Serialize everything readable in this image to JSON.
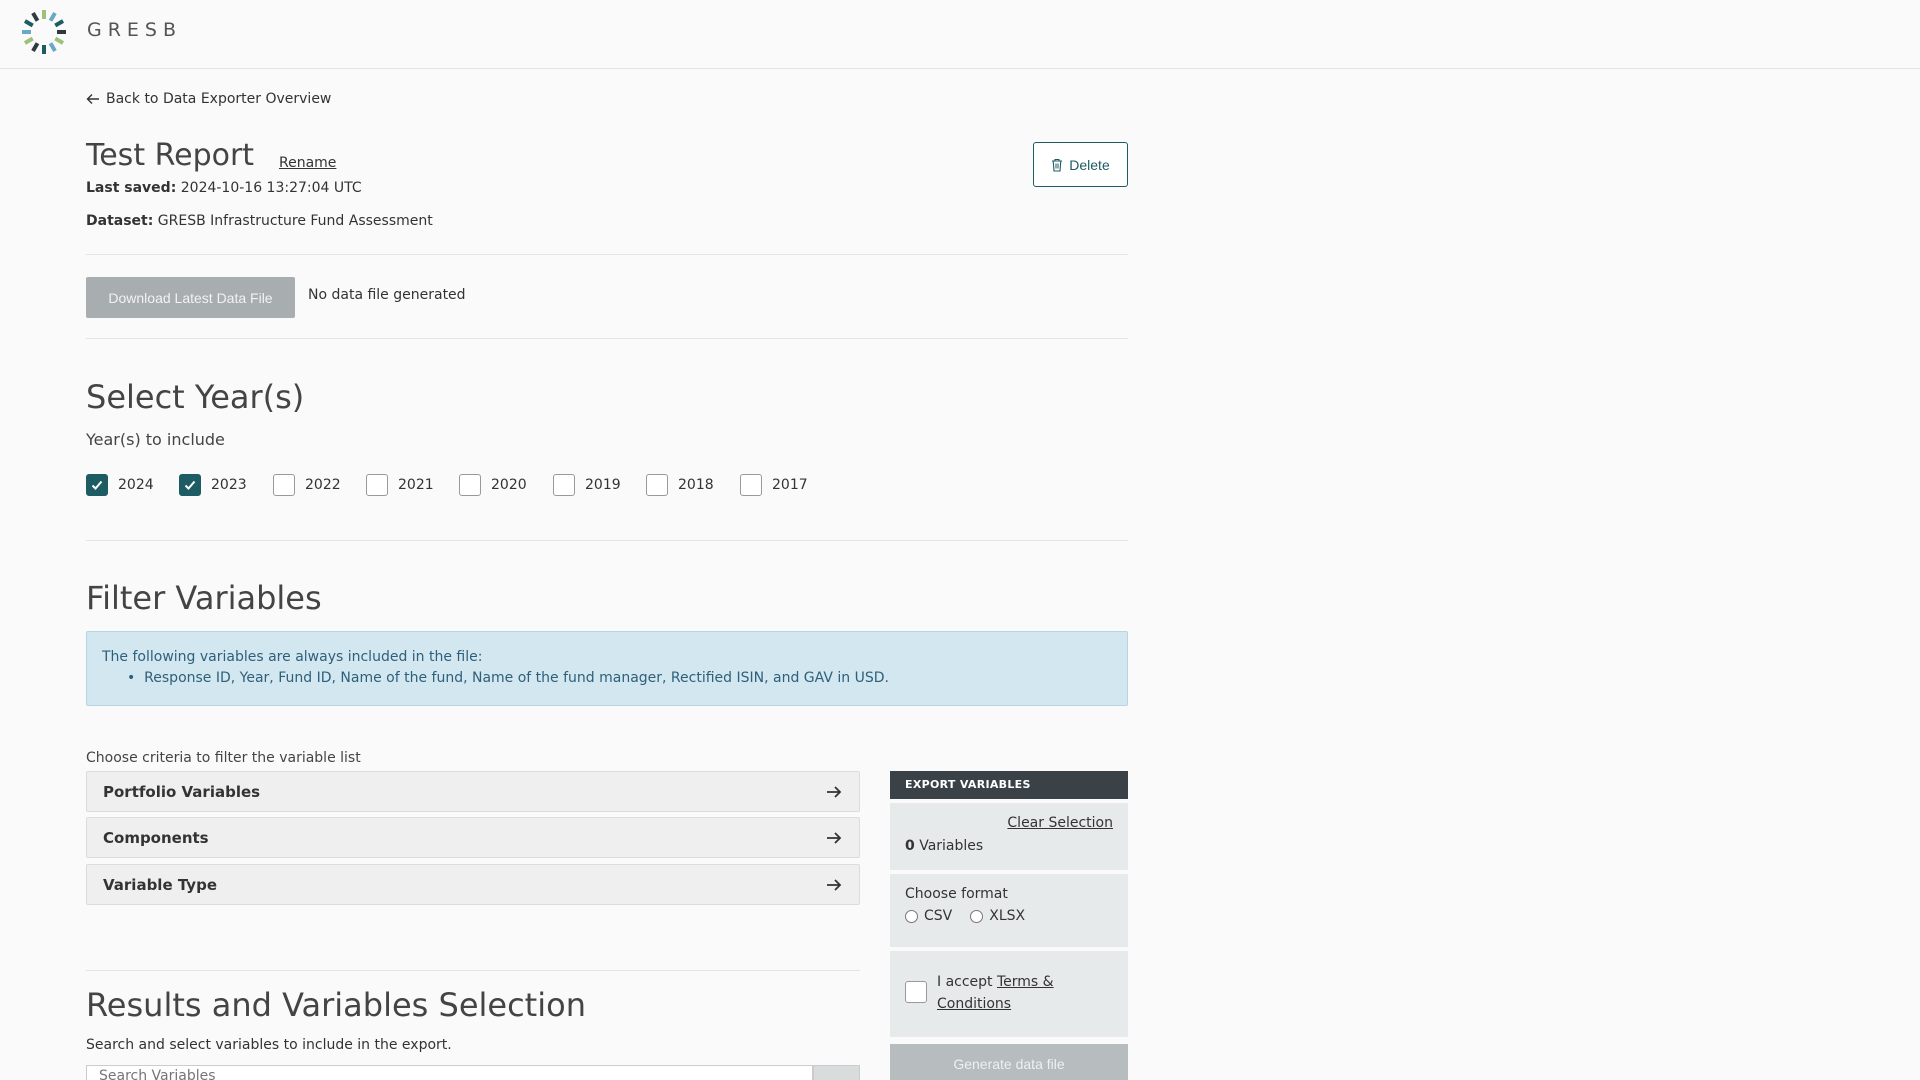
{
  "brand": {
    "name": "GRESB",
    "logo_icon": "gresb-logo-ring"
  },
  "nav": {
    "back_label": "Back to Data Exporter Overview"
  },
  "report": {
    "title": "Test Report",
    "rename_label": "Rename",
    "delete_label": "Delete",
    "last_saved_label": "Last saved:",
    "last_saved_value": "2024-10-16 13:27:04 UTC",
    "dataset_label": "Dataset:",
    "dataset_value": "GRESB Infrastructure Fund Assessment"
  },
  "download": {
    "button_label": "Download Latest Data File",
    "status_text": "No data file generated"
  },
  "years": {
    "title": "Select Year(s)",
    "subtitle": "Year(s) to include",
    "options": [
      {
        "label": "2024",
        "checked": true
      },
      {
        "label": "2023",
        "checked": true
      },
      {
        "label": "2022",
        "checked": false
      },
      {
        "label": "2021",
        "checked": false
      },
      {
        "label": "2020",
        "checked": false
      },
      {
        "label": "2019",
        "checked": false
      },
      {
        "label": "2018",
        "checked": false
      },
      {
        "label": "2017",
        "checked": false
      }
    ]
  },
  "filter": {
    "title": "Filter Variables",
    "info_intro": "The following variables are always included in the file:",
    "info_item": "Response ID, Year, Fund ID, Name of the fund, Name of the fund manager, Rectified ISIN, and GAV in USD.",
    "criteria_label": "Choose criteria to filter the variable list",
    "accordions": [
      "Portfolio Variables",
      "Components",
      "Variable Type"
    ]
  },
  "export_panel": {
    "header": "EXPORT VARIABLES",
    "clear_label": "Clear Selection",
    "count_value": "0",
    "count_suffix": "Variables",
    "format_label": "Choose format",
    "format_options": [
      "CSV",
      "XLSX"
    ],
    "accept_prefix": "I accept",
    "terms_link": "Terms & Conditions",
    "generate_label": "Generate data file"
  },
  "results": {
    "title": "Results and Variables Selection",
    "description": "Search and select variables to include in the export.",
    "search_placeholder": "Search Variables"
  },
  "colors": {
    "accent": "#1d5c63",
    "info_bg": "#d2e7ef",
    "panel_head": "#3b4247",
    "disabled_btn": "#a8adaf"
  }
}
